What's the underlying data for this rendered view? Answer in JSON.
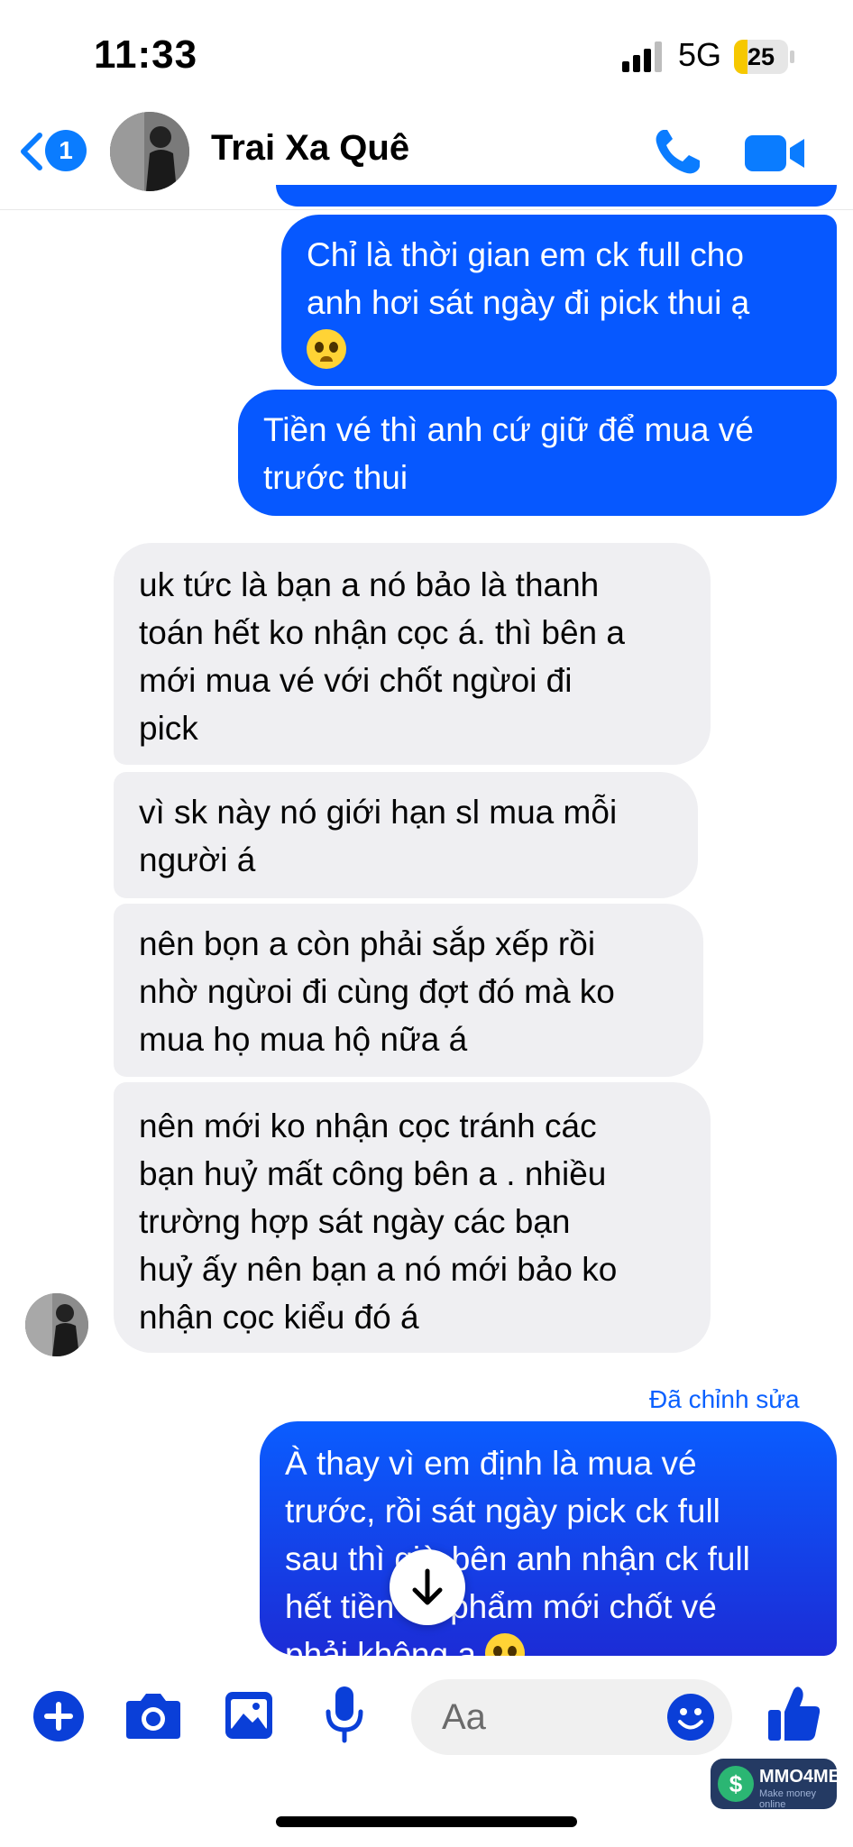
{
  "status_bar": {
    "time": "11:33",
    "network": "5G",
    "battery_level": "25",
    "battery_fraction": 0.25
  },
  "header": {
    "back_badge": "1",
    "contact_name": "Trai Xa Quê"
  },
  "messages": [
    {
      "side": "out",
      "text_lines": [
        "Chỉ là thời gian em ck full cho",
        "anh hơi sát ngày đi pick thui ạ"
      ],
      "trailing_emoji": "pleading-face"
    },
    {
      "side": "out",
      "text_lines": [
        "Tiền vé thì anh cứ giữ để mua vé",
        "trước thui"
      ]
    },
    {
      "side": "in",
      "text_lines": [
        "uk tức là bạn a nó bảo là thanh",
        "toán hết ko nhận cọc á. thì bên a",
        "mới mua vé với chốt  ngừoi đi",
        "pick"
      ]
    },
    {
      "side": "in",
      "text_lines": [
        "vì sk này nó giới hạn sl mua mỗi",
        "người á"
      ]
    },
    {
      "side": "in",
      "text_lines": [
        "nên bọn a còn phải sắp xếp rồi",
        "nhờ ngừoi đi cùng đợt đó mà ko",
        "mua họ mua hộ nữa á"
      ]
    },
    {
      "side": "in",
      "text_lines": [
        "nên mới ko nhận cọc tránh các",
        "bạn huỷ mất công bên a . nhiều",
        "trường hợp sát ngày các bạn",
        "huỷ ấy nên  bạn a nó mới bảo ko",
        "nhận cọc kiểu đó á"
      ]
    },
    {
      "side": "out",
      "edited_label": "Đã chỉnh sửa",
      "text_lines": [
        "À thay vì em định là mua vé",
        "trước, rồi sát ngày pick ck full",
        "sau thì giờ bên anh nhận ck full",
        "hết tiền ấn phẩm mới chốt vé",
        "phải không ạ"
      ],
      "trailing_emoji": "pleading-face"
    }
  ],
  "composer": {
    "placeholder": "Aa"
  },
  "watermark": {
    "title": "MMO4ME",
    "subtitle": "Make money online"
  },
  "colors": {
    "accent": "#0A7CFF",
    "outgoing_bubble": "#0658FF",
    "incoming_bubble": "#EFEFF2"
  }
}
